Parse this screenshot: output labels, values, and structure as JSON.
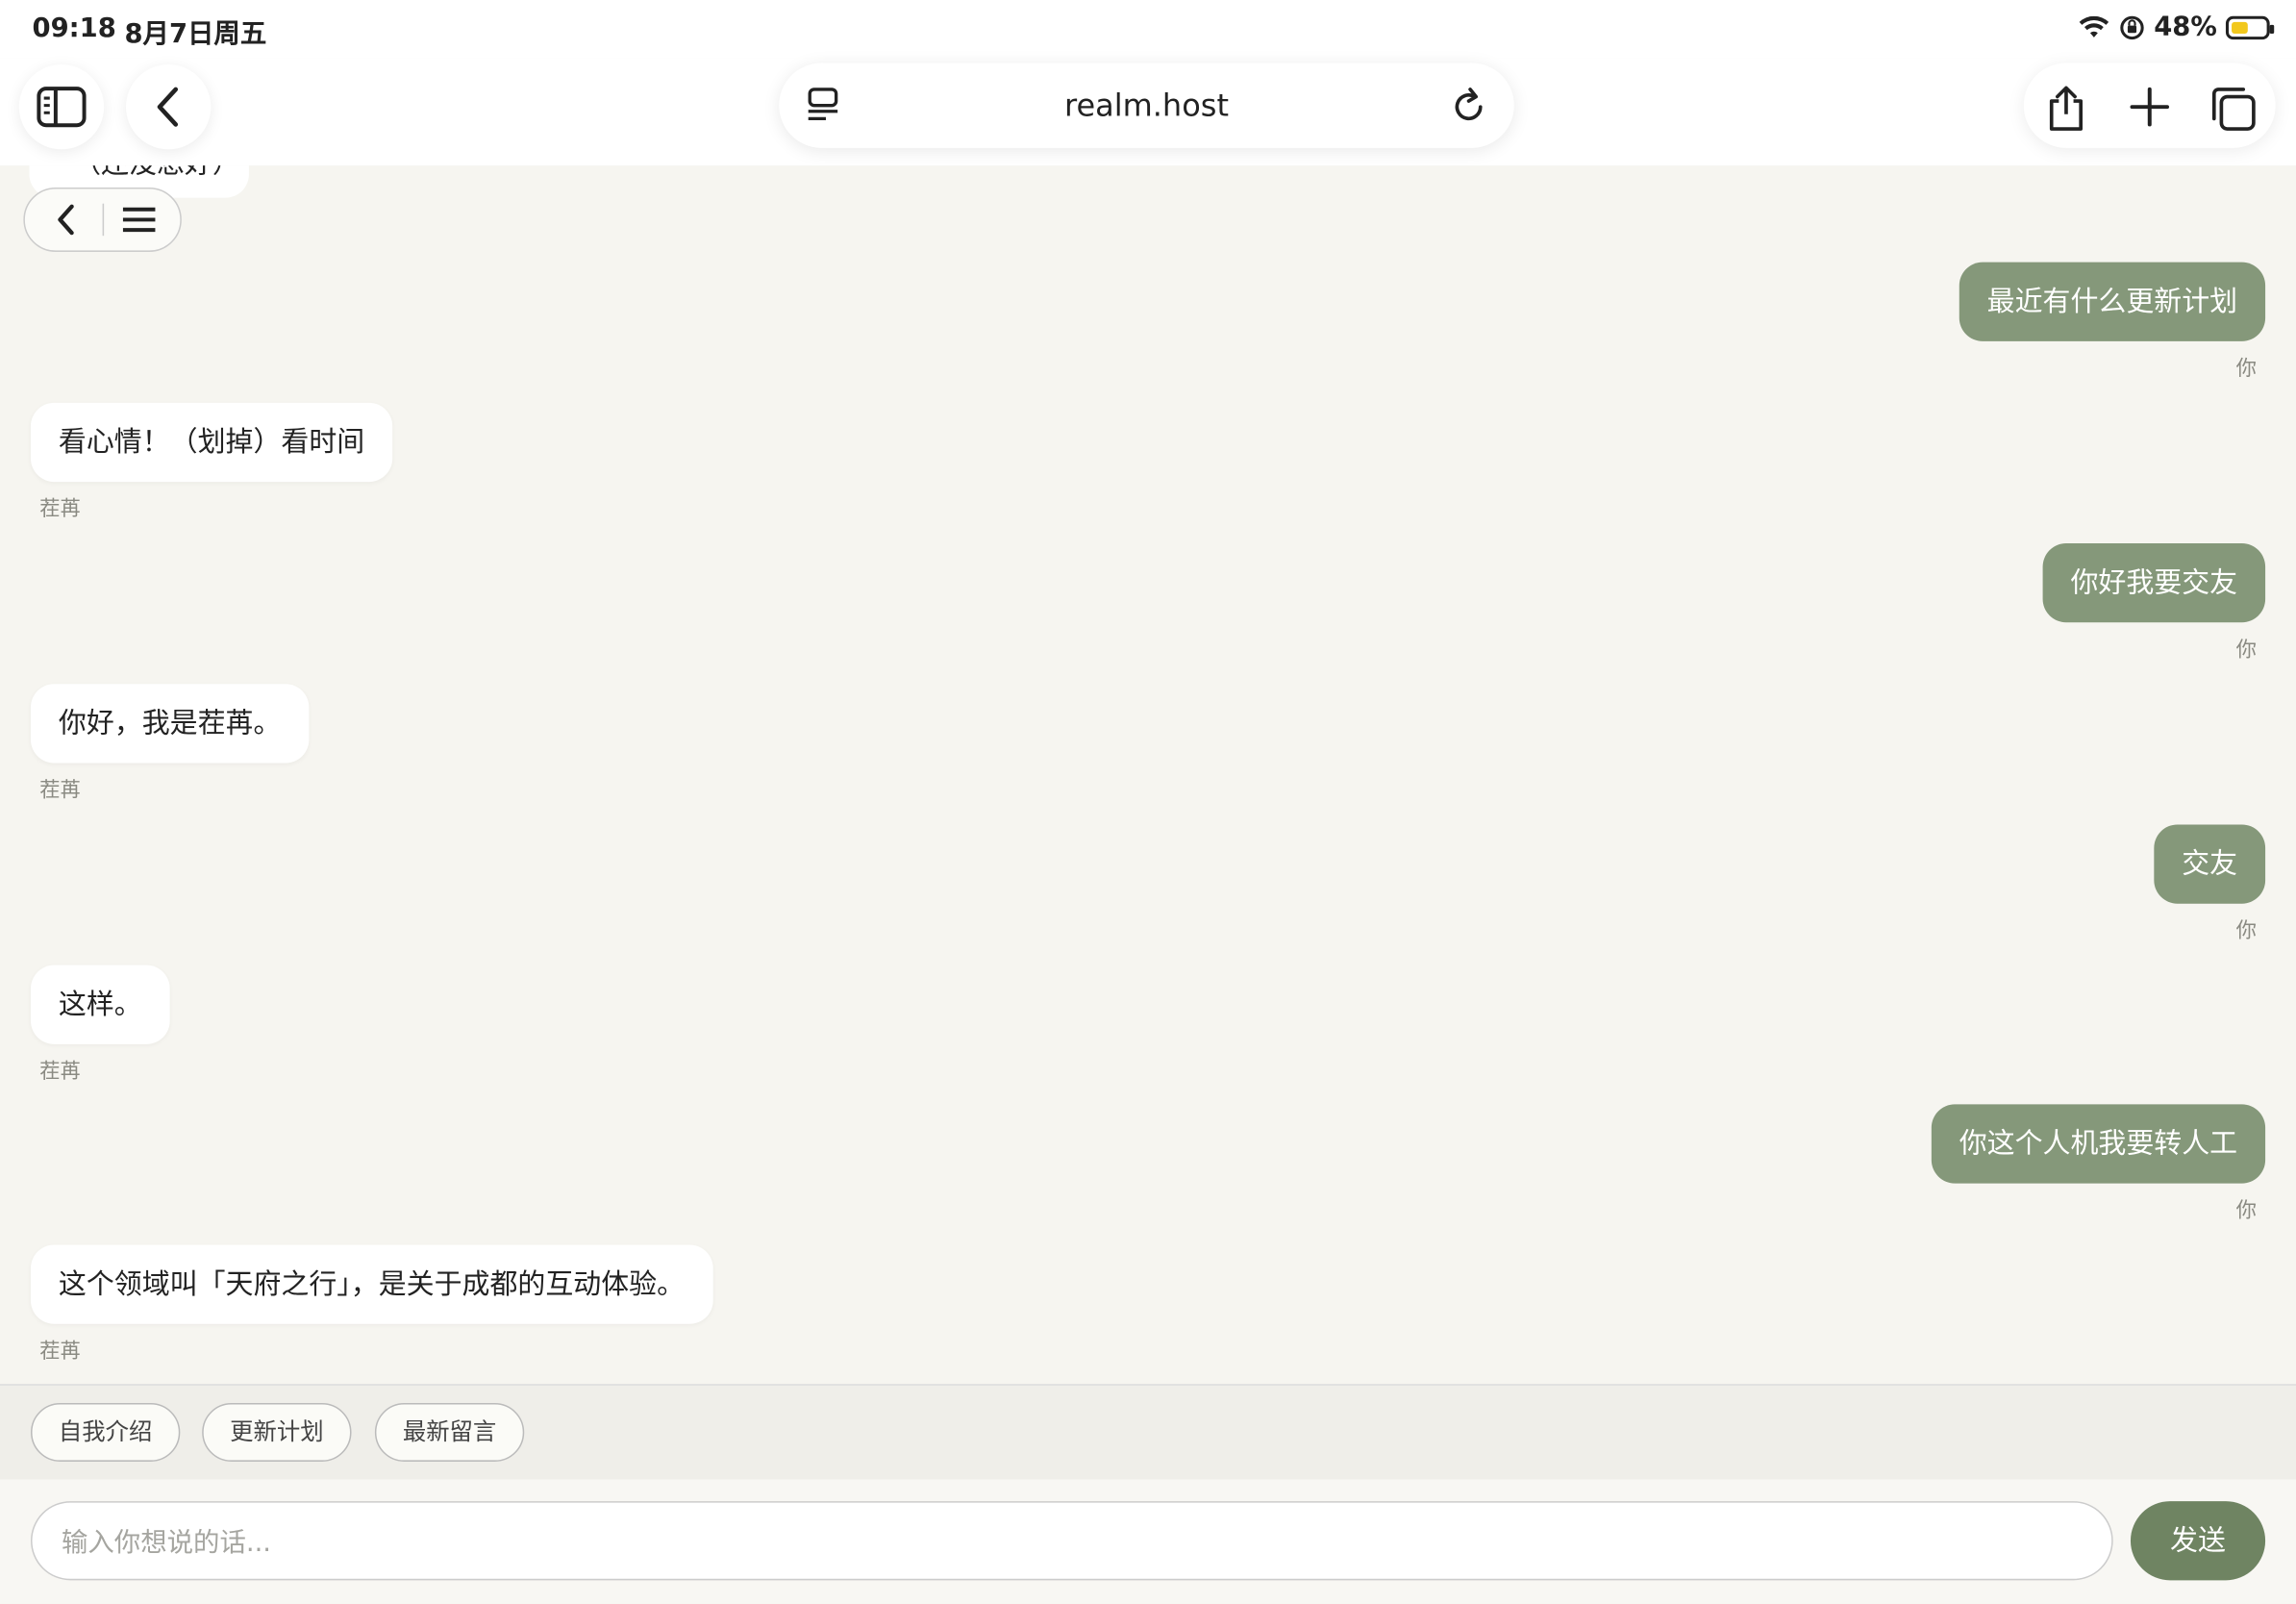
{
  "status_bar": {
    "time": "09:18",
    "date": "8月7日周五",
    "battery": "48%",
    "battery_level": 0.48
  },
  "browser": {
    "url": "realm.host"
  },
  "chat": {
    "partial_top_text": "（还没想好）",
    "messages": [
      {
        "role": "me",
        "text": "最近有什么更新计划",
        "sender": "你"
      },
      {
        "role": "bot",
        "text": "看心情！（划掉）看时间",
        "sender": "茬苒"
      },
      {
        "role": "me",
        "text": "你好我要交友",
        "sender": "你"
      },
      {
        "role": "bot",
        "text": "你好，我是茬苒。",
        "sender": "茬苒"
      },
      {
        "role": "me",
        "text": "交友",
        "sender": "你"
      },
      {
        "role": "bot",
        "text": "这样。",
        "sender": "茬苒"
      },
      {
        "role": "me",
        "text": "你这个人机我要转人工",
        "sender": "你"
      },
      {
        "role": "bot",
        "text": "这个领域叫「天府之行」，是关于成都的互动体验。",
        "sender": "茬苒"
      }
    ]
  },
  "quick_replies": [
    "自我介绍",
    "更新计划",
    "最新留言"
  ],
  "composer": {
    "placeholder": "输入你想说的话...",
    "send_label": "发送"
  },
  "colors": {
    "user_bubble": "#85987a",
    "send_button": "#6f8462",
    "background": "#f6f5f0"
  }
}
